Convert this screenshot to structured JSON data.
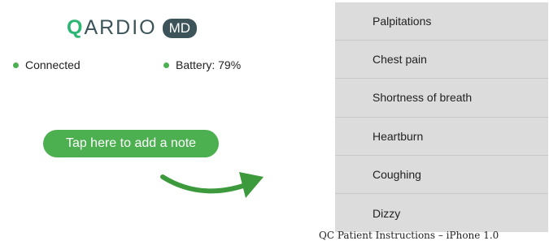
{
  "logo": {
    "brand_q": "Q",
    "brand_rest": "ARDIO",
    "badge": "MD"
  },
  "status": {
    "connected_label": "Connected",
    "battery_label": "Battery: 79%",
    "indicator_color": "#4caf50"
  },
  "note_button": {
    "label": "Tap here to add a note"
  },
  "symptoms": {
    "items": [
      {
        "label": "Palpitations"
      },
      {
        "label": "Chest pain"
      },
      {
        "label": "Shortness of breath"
      },
      {
        "label": "Heartburn"
      },
      {
        "label": "Coughing"
      },
      {
        "label": "Dizzy"
      }
    ]
  },
  "caption": "QC Patient Instructions – iPhone 1.0",
  "colors": {
    "accent": "#4caf50",
    "brand_dark": "#3c5459",
    "menu_bg": "#dcdcdc"
  },
  "icons": {
    "arrow": "curved-arrow-icon"
  }
}
